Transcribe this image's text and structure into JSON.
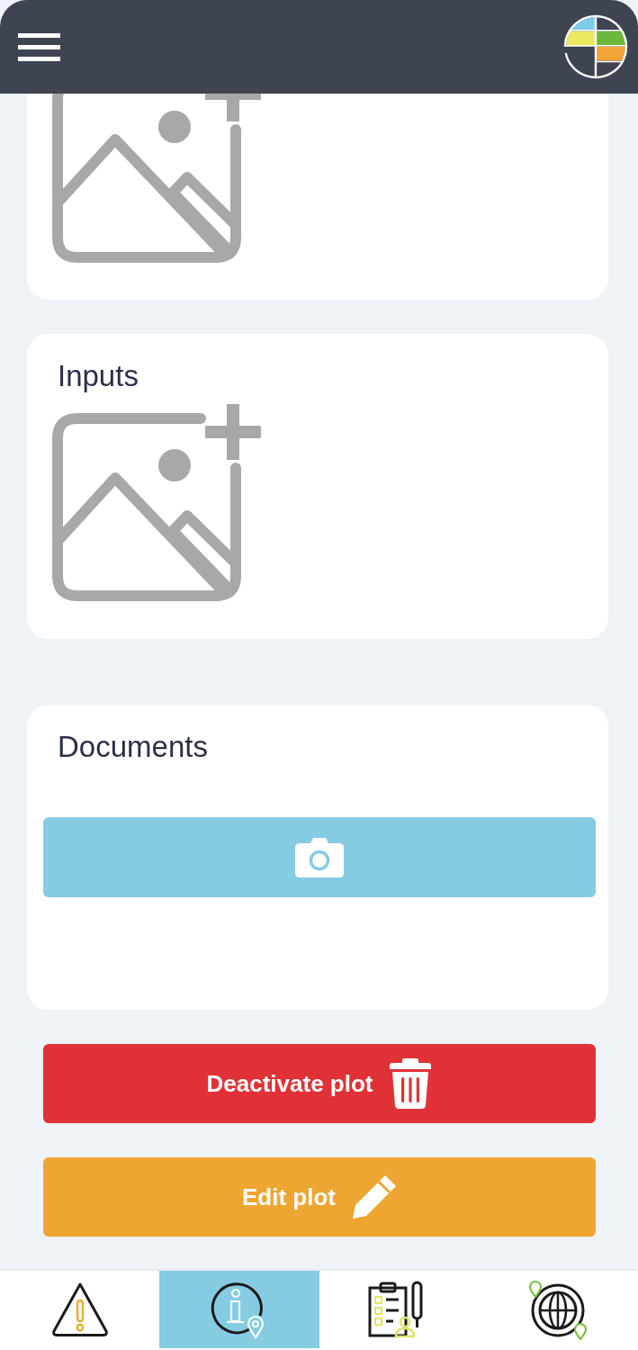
{
  "sections": [
    {
      "kind": "image_upload",
      "clipped": true
    },
    {
      "kind": "image_upload",
      "clipped": false,
      "title": "Inputs"
    },
    {
      "kind": "documents",
      "clipped": false,
      "title": "Documents"
    }
  ],
  "actions": [
    {
      "kind": "danger",
      "label": "Deactivate plot"
    },
    {
      "kind": "edit",
      "label": "Edit plot"
    }
  ],
  "bottom_nav": [
    {
      "kind": "alerts",
      "selected": false
    },
    {
      "kind": "info",
      "selected": true
    },
    {
      "kind": "forms",
      "selected": false
    },
    {
      "kind": "map",
      "selected": false
    }
  ]
}
